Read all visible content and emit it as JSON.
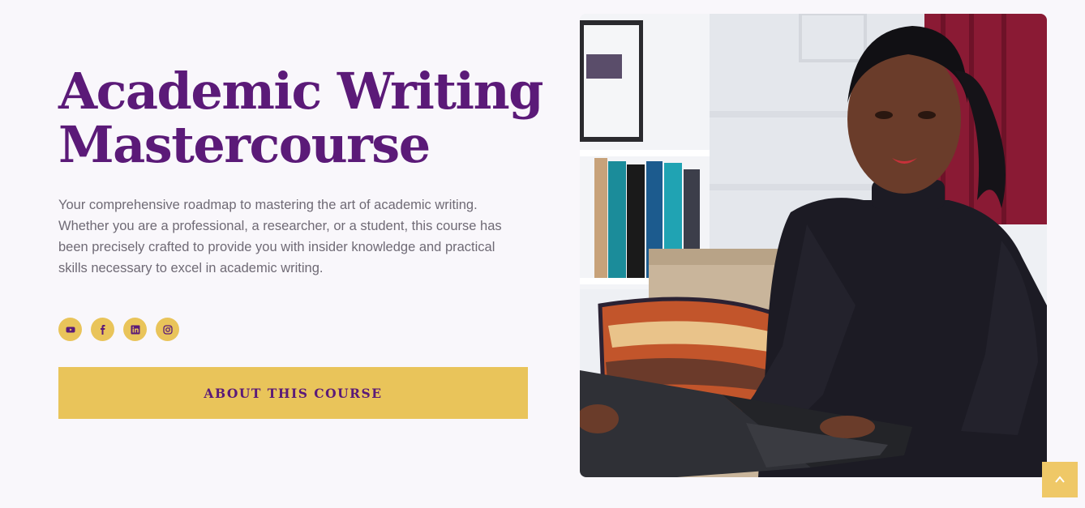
{
  "hero": {
    "title_line1": "Academic Writing",
    "title_line2": "Mastercourse",
    "description": "Your comprehensive roadmap to mastering the art of academic writing. Whether you are a professional, a researcher, or a student, this course has been precisely crafted to provide you with insider knowledge and practical skills necessary to excel in academic writing.",
    "cta_label": "ABOUT THIS COURSE"
  },
  "socials": [
    {
      "icon": "youtube-icon"
    },
    {
      "icon": "facebook-icon"
    },
    {
      "icon": "linkedin-icon"
    },
    {
      "icon": "instagram-icon"
    }
  ],
  "colors": {
    "background": "#f9f7fb",
    "brand_purple": "#5b1a78",
    "accent_gold": "#e9c45a",
    "body_text": "#6f6a75"
  },
  "scroll_top": {
    "icon": "chevron-up-icon"
  }
}
